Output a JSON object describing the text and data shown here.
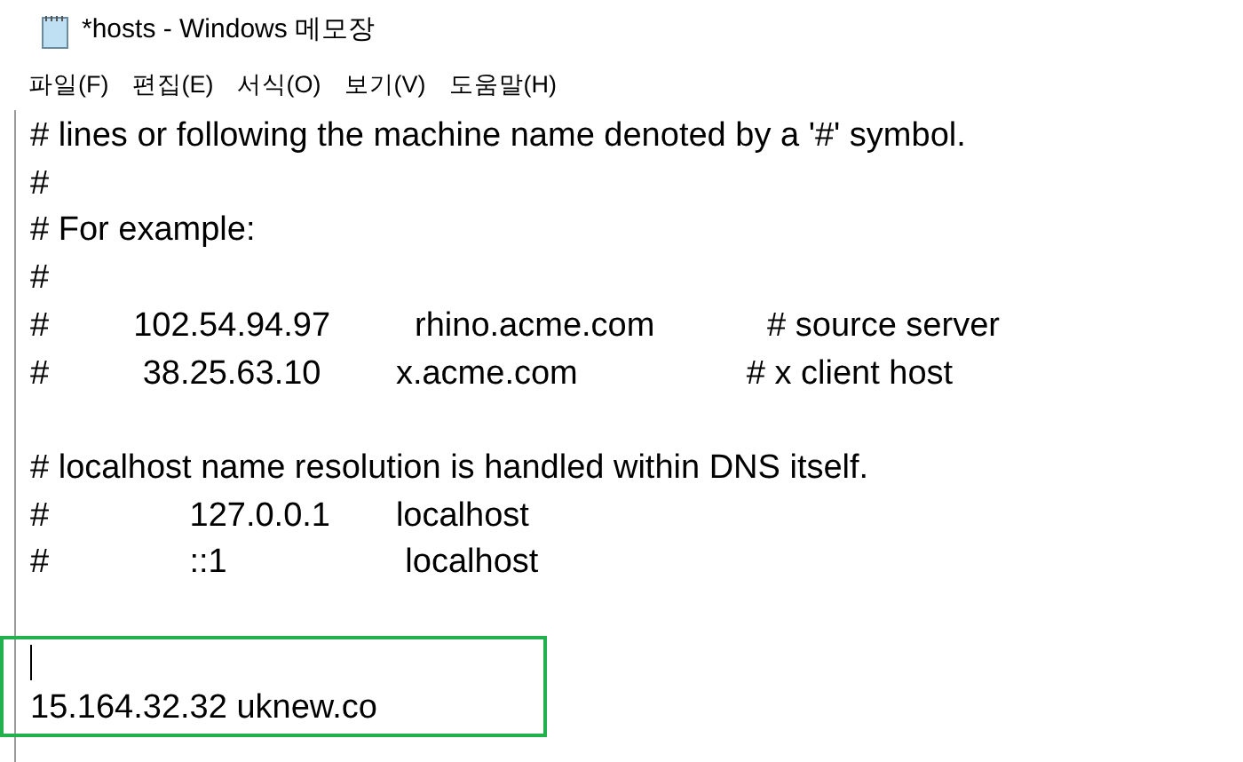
{
  "window": {
    "title": "*hosts - Windows 메모장"
  },
  "menu": [
    "파일(F)",
    "편집(E)",
    "서식(O)",
    "보기(V)",
    "도움말(H)"
  ],
  "lines": [
    {
      "kind": "text",
      "text": "# lines or following the machine name denoted by a '#' symbol."
    },
    {
      "kind": "text",
      "text": "#"
    },
    {
      "kind": "text",
      "text": "# For example:"
    },
    {
      "kind": "text",
      "text": "#"
    },
    {
      "kind": "text",
      "text": "#         102.54.94.97         rhino.acme.com            # source server"
    },
    {
      "kind": "text",
      "text": "#          38.25.63.10        x.acme.com                  # x client host"
    },
    {
      "kind": "blank"
    },
    {
      "kind": "text",
      "text": "# localhost name resolution is handled within DNS itself."
    },
    {
      "kind": "text",
      "text": "#               127.0.0.1       localhost"
    },
    {
      "kind": "text",
      "text": "#               ::1                   localhost"
    },
    {
      "kind": "blank"
    }
  ],
  "highlighted_lines": [
    {
      "kind": "caret"
    },
    {
      "kind": "text",
      "text": "15.164.32.32 uknew.co"
    }
  ]
}
